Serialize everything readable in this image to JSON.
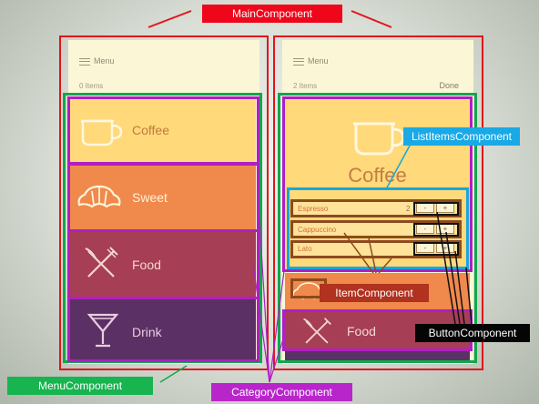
{
  "labels": {
    "main": "MainComponent",
    "list_items": "ListItemsComponent",
    "item": "ItemComponent",
    "button": "ButtonComponent",
    "menu": "MenuComponent",
    "category": "CategoryComponent"
  },
  "left_screen": {
    "menu_label": "Menu",
    "item_count": "0 Items",
    "categories": [
      "Coffee",
      "Sweet",
      "Food",
      "Drink"
    ]
  },
  "right_screen": {
    "menu_label": "Menu",
    "item_count": "2 Items",
    "done_label": "Done",
    "selected_category": "Coffee",
    "items": [
      {
        "name": "Espresso",
        "qty": "2"
      },
      {
        "name": "Cappuccino",
        "qty": ""
      },
      {
        "name": "Lato",
        "qty": ""
      }
    ],
    "minus_label": "-",
    "plus_label": "+",
    "lower_category": "Food"
  },
  "colors": {
    "main_component": "#e2141b",
    "menu_component": "#10a84a",
    "category_component": "#b01ec4",
    "list_items_component": "#14a8e0",
    "item_component": "#8c4a1d",
    "button_component": "#111111"
  }
}
